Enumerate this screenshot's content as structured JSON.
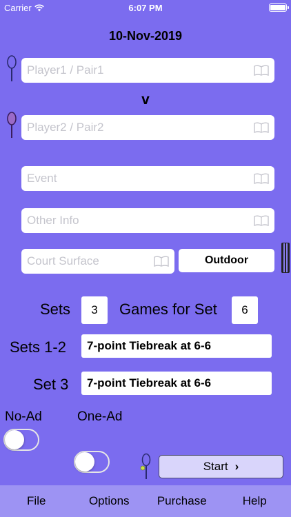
{
  "status_bar": {
    "carrier": "Carrier",
    "time": "6:07 PM",
    "wifi_icon": "wifi-icon",
    "battery_level": 1.0
  },
  "date": "10-Nov-2019",
  "player1": {
    "placeholder": "Player1 / Pair1"
  },
  "versus": "v",
  "player2": {
    "placeholder": "Player2 / Pair2"
  },
  "event": {
    "placeholder": "Event"
  },
  "other_info": {
    "placeholder": "Other Info"
  },
  "court_surface": {
    "placeholder": "Court Surface"
  },
  "outdoor_button": "Outdoor",
  "sets": {
    "label": "Sets",
    "value": "3"
  },
  "games_for_set": {
    "label": "Games for Set",
    "value": "6"
  },
  "sets_1_2": {
    "label": "Sets 1-2",
    "value": "7-point Tiebreak at 6-6"
  },
  "set_3": {
    "label": "Set 3",
    "value": "7-point Tiebreak at 6-6"
  },
  "no_ad": {
    "label": "No-Ad",
    "on": false
  },
  "one_ad": {
    "label": "One-Ad",
    "on": false
  },
  "start_button": {
    "label": "Start",
    "chevron": "›"
  },
  "tabbar": [
    "File",
    "Options",
    "Purchase",
    "Help"
  ],
  "colors": {
    "background": "#7b6cef",
    "tabbar": "#9d93f3",
    "start_button": "#d9d5fb",
    "racket1": "#3b3b8f",
    "racket2": "#7a3fa8"
  }
}
